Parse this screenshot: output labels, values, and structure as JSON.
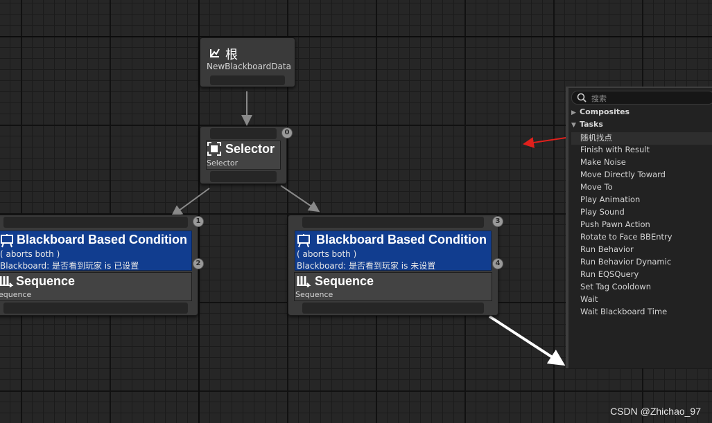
{
  "root_node": {
    "title": "根",
    "subtitle": "NewBlackboardData",
    "icon": "root-icon"
  },
  "selector_node": {
    "title": "Selector",
    "subtitle": "Selector",
    "icon": "selector-icon",
    "index": "0"
  },
  "left_branch": {
    "decorator": {
      "title": "Blackboard Based Condition",
      "line1": "( aborts both )",
      "line2": "Blackboard: 是否看到玩家 is 已设置",
      "icon": "blackboard-icon",
      "index": "2"
    },
    "composite": {
      "title": "Sequence",
      "subtitle": "Sequence",
      "icon": "sequence-icon",
      "index": "1"
    }
  },
  "right_branch": {
    "decorator": {
      "title": "Blackboard Based Condition",
      "line1": "( aborts both )",
      "line2": "Blackboard: 是否看到玩家 is 未设置",
      "icon": "blackboard-icon",
      "index": "4"
    },
    "composite": {
      "title": "Sequence",
      "subtitle": "Sequence",
      "icon": "sequence-icon",
      "index": "3"
    }
  },
  "palette": {
    "search_placeholder": "搜索",
    "categories": [
      {
        "label": "Composites",
        "expanded": false
      },
      {
        "label": "Tasks",
        "expanded": true
      }
    ],
    "tasks": [
      "随机找点",
      "Finish with Result",
      "Make Noise",
      "Move Directly Toward",
      "Move To",
      "Play Animation",
      "Play Sound",
      "Push Pawn Action",
      "Rotate to Face BBEntry",
      "Run Behavior",
      "Run Behavior Dynamic",
      "Run EQSQuery",
      "Set Tag Cooldown",
      "Wait",
      "Wait Blackboard Time"
    ]
  },
  "colors": {
    "decorator_blue": "#113d8f",
    "annotation_red": "#e0201c",
    "node_gray": "#3a3a3a"
  },
  "watermark": "CSDN @Zhichao_97"
}
